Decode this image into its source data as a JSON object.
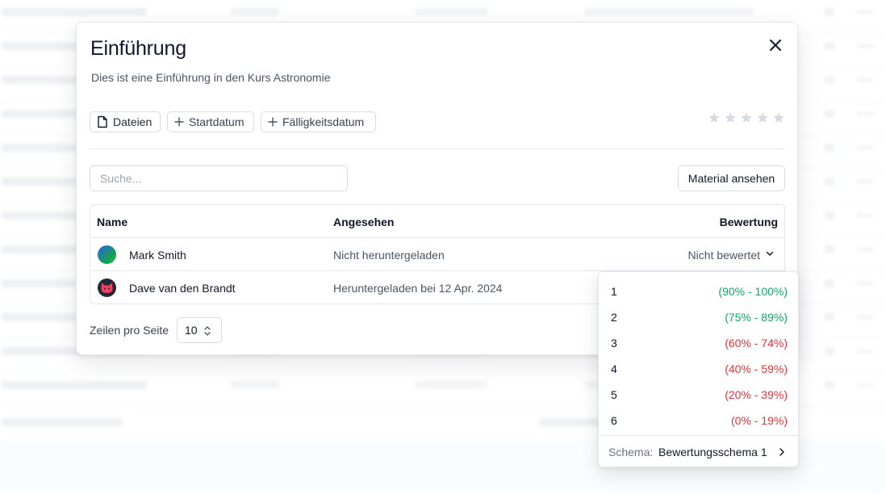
{
  "background": {
    "footer_visible": true
  },
  "modal": {
    "title": "Einführung",
    "description": "Dies ist eine Einführung in den Kurs Astronomie",
    "chips": {
      "files": "Dateien",
      "start_date": "Startdatum",
      "due_date": "Fälligkeitsdatum"
    },
    "rating_stars": {
      "count": 5,
      "filled": 0
    },
    "search": {
      "placeholder": "Suche...",
      "value": ""
    },
    "material_button": "Material ansehen",
    "table": {
      "headers": {
        "name": "Name",
        "seen": "Angesehen",
        "rating": "Bewertung"
      },
      "rows": [
        {
          "name": "Mark Smith",
          "seen": "Nicht heruntergeladen",
          "rating": "Nicht bewertet",
          "avatar": "gradient-avatar"
        },
        {
          "name": "Dave van den Brandt",
          "seen": "Heruntergeladen bei 12 Apr. 2024",
          "rating": "",
          "avatar": "cat-avatar"
        }
      ]
    },
    "pagination": {
      "rows_label": "Zeilen pro Seite",
      "rows_value": "10"
    }
  },
  "grade_dropdown": {
    "items": [
      {
        "grade": "1",
        "range": "(90% - 100%)",
        "color": "#10a56a"
      },
      {
        "grade": "2",
        "range": "(75% - 89%)",
        "color": "#10a56a"
      },
      {
        "grade": "3",
        "range": "(60% - 74%)",
        "color": "#e5343a"
      },
      {
        "grade": "4",
        "range": "(40% - 59%)",
        "color": "#e5343a"
      },
      {
        "grade": "5",
        "range": "(20% - 39%)",
        "color": "#e5343a"
      },
      {
        "grade": "6",
        "range": "(0% - 19%)",
        "color": "#e5343a"
      }
    ],
    "schema_label": "Schema:",
    "schema_value": "Bewertungsschema 1"
  },
  "colors": {
    "passing": "#10a56a",
    "failing": "#e5343a",
    "star_empty": "#d6dbe4"
  }
}
